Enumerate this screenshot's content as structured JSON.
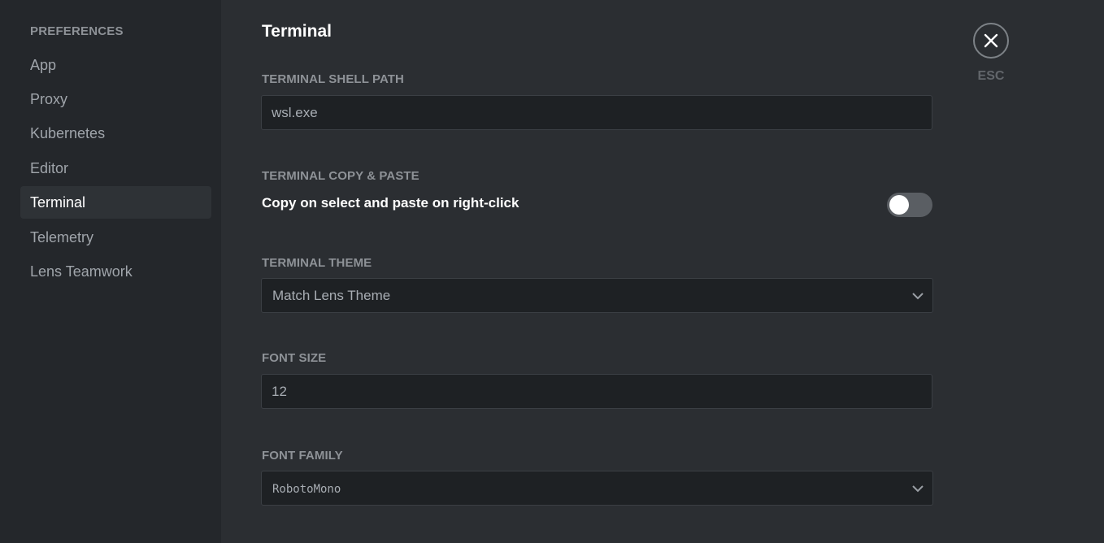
{
  "sidebar": {
    "heading": "PREFERENCES",
    "items": [
      {
        "label": "App"
      },
      {
        "label": "Proxy"
      },
      {
        "label": "Kubernetes"
      },
      {
        "label": "Editor"
      },
      {
        "label": "Terminal"
      },
      {
        "label": "Telemetry"
      },
      {
        "label": "Lens Teamwork"
      }
    ],
    "active_item": "Terminal"
  },
  "main": {
    "title": "Terminal",
    "shell_path": {
      "label": "TERMINAL SHELL PATH",
      "value": "wsl.exe"
    },
    "copy_paste": {
      "label": "TERMINAL COPY & PASTE",
      "toggle_text": "Copy on select and paste on right-click",
      "enabled": false
    },
    "theme": {
      "label": "TERMINAL THEME",
      "selected": "Match Lens Theme"
    },
    "font_size": {
      "label": "FONT SIZE",
      "value": "12"
    },
    "font_family": {
      "label": "FONT FAMILY",
      "selected": "RobotoMono"
    }
  },
  "close": {
    "icon": "close-icon",
    "label": "ESC"
  },
  "colors": {
    "sidebar_bg": "#24272b",
    "main_bg": "#2b2e32",
    "active_item_bg": "#2e3236",
    "input_bg": "#1e2124"
  }
}
